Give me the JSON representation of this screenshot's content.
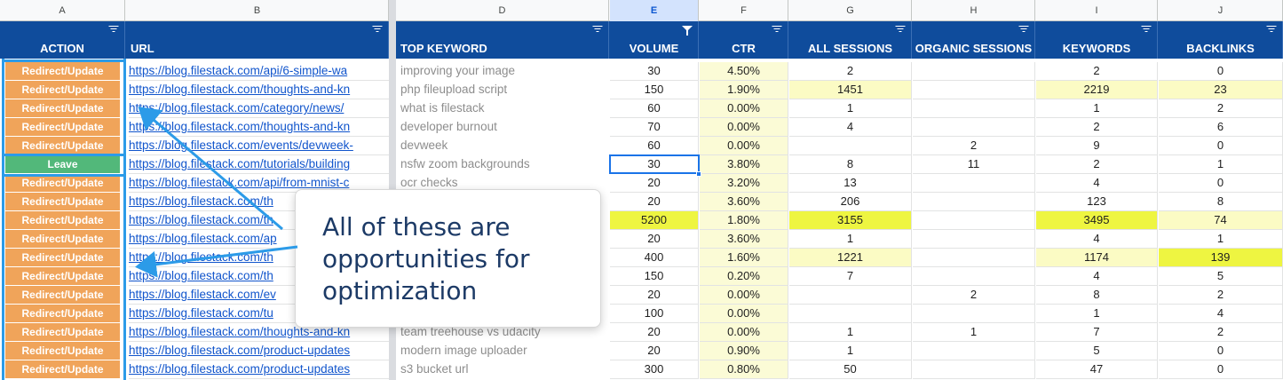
{
  "columns": {
    "letters": [
      "A",
      "B",
      "D",
      "E",
      "F",
      "G",
      "H",
      "I",
      "J"
    ],
    "selected_letter": "E",
    "headers": [
      "ACTION",
      "URL",
      "TOP KEYWORD",
      "VOLUME",
      "CTR",
      "ALL SESSIONS",
      "ORGANIC SESSIONS",
      "KEYWORDS",
      "BACKLINKS"
    ],
    "filter_active_column": "E"
  },
  "rows": [
    {
      "action": "Redirect/Update",
      "url": "https://blog.filestack.com/api/6-simple-wa",
      "keyword": "improving your image",
      "volume": "30",
      "ctr": "4.50%",
      "all_sessions": "2",
      "organic_sessions": "",
      "keywords": "2",
      "backlinks": "0"
    },
    {
      "action": "Redirect/Update",
      "url": "https://blog.filestack.com/thoughts-and-kn",
      "keyword": "php fileupload script",
      "volume": "150",
      "ctr": "1.90%",
      "all_sessions": "1451",
      "organic_sessions": "",
      "keywords": "2219",
      "backlinks": "23"
    },
    {
      "action": "Redirect/Update",
      "url": "https://blog.filestack.com/category/news/",
      "keyword": "what is filestack",
      "volume": "60",
      "ctr": "0.00%",
      "all_sessions": "1",
      "organic_sessions": "",
      "keywords": "1",
      "backlinks": "2"
    },
    {
      "action": "Redirect/Update",
      "url": "https://blog.filestack.com/thoughts-and-kn",
      "keyword": "developer burnout",
      "volume": "70",
      "ctr": "0.00%",
      "all_sessions": "4",
      "organic_sessions": "",
      "keywords": "2",
      "backlinks": "6"
    },
    {
      "action": "Redirect/Update",
      "url": "https://blog.filestack.com/events/devweek-",
      "keyword": "devweek",
      "volume": "60",
      "ctr": "0.00%",
      "all_sessions": "",
      "organic_sessions": "2",
      "keywords": "9",
      "backlinks": "0"
    },
    {
      "action": "Leave",
      "url": "https://blog.filestack.com/tutorials/building",
      "keyword": "nsfw zoom backgrounds",
      "volume": "30",
      "ctr": "3.80%",
      "all_sessions": "8",
      "organic_sessions": "11",
      "keywords": "2",
      "backlinks": "1"
    },
    {
      "action": "Redirect/Update",
      "url": "https://blog.filestack.com/api/from-mnist-c",
      "keyword": "ocr checks",
      "volume": "20",
      "ctr": "3.20%",
      "all_sessions": "13",
      "organic_sessions": "",
      "keywords": "4",
      "backlinks": "0"
    },
    {
      "action": "Redirect/Update",
      "url": "https://blog.filestack.com/th",
      "keyword": "",
      "volume": "20",
      "ctr": "3.60%",
      "all_sessions": "206",
      "organic_sessions": "",
      "keywords": "123",
      "backlinks": "8"
    },
    {
      "action": "Redirect/Update",
      "url": "https://blog.filestack.com/th",
      "keyword": "",
      "volume": "5200",
      "ctr": "1.80%",
      "all_sessions": "3155",
      "organic_sessions": "",
      "keywords": "3495",
      "backlinks": "74"
    },
    {
      "action": "Redirect/Update",
      "url": "https://blog.filestack.com/ap",
      "keyword": "",
      "volume": "20",
      "ctr": "3.60%",
      "all_sessions": "1",
      "organic_sessions": "",
      "keywords": "4",
      "backlinks": "1"
    },
    {
      "action": "Redirect/Update",
      "url": "https://blog.filestack.com/th",
      "keyword": "",
      "volume": "400",
      "ctr": "1.60%",
      "all_sessions": "1221",
      "organic_sessions": "",
      "keywords": "1174",
      "backlinks": "139"
    },
    {
      "action": "Redirect/Update",
      "url": "https://blog.filestack.com/th",
      "keyword": "",
      "volume": "150",
      "ctr": "0.20%",
      "all_sessions": "7",
      "organic_sessions": "",
      "keywords": "4",
      "backlinks": "5"
    },
    {
      "action": "Redirect/Update",
      "url": "https://blog.filestack.com/ev",
      "keyword": "",
      "volume": "20",
      "ctr": "0.00%",
      "all_sessions": "",
      "organic_sessions": "2",
      "keywords": "8",
      "backlinks": "2"
    },
    {
      "action": "Redirect/Update",
      "url": "https://blog.filestack.com/tu",
      "keyword": "",
      "volume": "100",
      "ctr": "0.00%",
      "all_sessions": "",
      "organic_sessions": "",
      "keywords": "1",
      "backlinks": "4"
    },
    {
      "action": "Redirect/Update",
      "url": "https://blog.filestack.com/thoughts-and-kn",
      "keyword": "team treehouse vs udacity",
      "volume": "20",
      "ctr": "0.00%",
      "all_sessions": "1",
      "organic_sessions": "1",
      "keywords": "7",
      "backlinks": "2"
    },
    {
      "action": "Redirect/Update",
      "url": "https://blog.filestack.com/product-updates",
      "keyword": "modern image uploader",
      "volume": "20",
      "ctr": "0.90%",
      "all_sessions": "1",
      "organic_sessions": "",
      "keywords": "5",
      "backlinks": "0"
    },
    {
      "action": "Redirect/Update",
      "url": "https://blog.filestack.com/product-updates",
      "keyword": "s3 bucket url",
      "volume": "300",
      "ctr": "0.80%",
      "all_sessions": "50",
      "organic_sessions": "",
      "keywords": "47",
      "backlinks": "0"
    }
  ],
  "selected_cell": {
    "column": "E",
    "row_index": 5,
    "value": "30"
  },
  "callout": {
    "text": "All of these are opportunities for optimization"
  },
  "colors": {
    "header_bg": "#0f4c9c",
    "redirect_bg": "#f0a45a",
    "leave_bg": "#52b87a",
    "url_link": "#1155cc",
    "highlight_strong": "#eef541",
    "highlight_light": "#fbfbc4",
    "ctr_bg": "#fbfbd6",
    "annotation_blue": "#2c9be8",
    "callout_text": "#1c3a66"
  }
}
